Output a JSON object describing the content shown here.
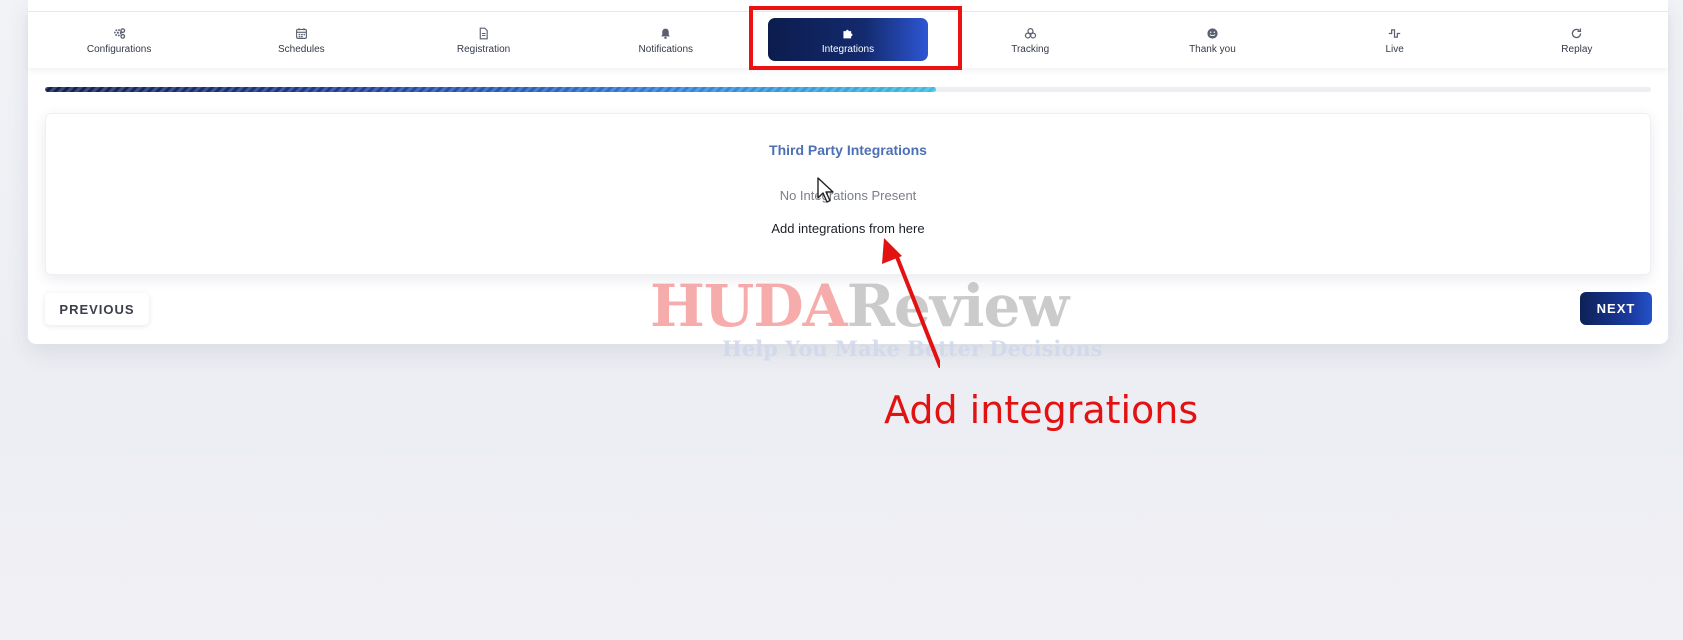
{
  "tabs": [
    {
      "label": "Configurations",
      "icon": "gears-icon"
    },
    {
      "label": "Schedules",
      "icon": "calendar-icon"
    },
    {
      "label": "Registration",
      "icon": "document-icon"
    },
    {
      "label": "Notifications",
      "icon": "bell-icon"
    },
    {
      "label": "Integrations",
      "icon": "puzzle-icon",
      "active": true
    },
    {
      "label": "Tracking",
      "icon": "tracking-icon"
    },
    {
      "label": "Thank you",
      "icon": "smile-icon"
    },
    {
      "label": "Live",
      "icon": "pulse-icon"
    },
    {
      "label": "Replay",
      "icon": "replay-icon"
    }
  ],
  "progress": {
    "fraction": 0.555
  },
  "panel": {
    "title": "Third Party Integrations",
    "empty_text": "No Integrations Present",
    "add_text": "Add integrations from here"
  },
  "buttons": {
    "previous": "PREVIOUS",
    "next": "NEXT"
  },
  "watermark": {
    "part1": "HUDA",
    "part2": "Review",
    "tagline": "Help You Make Better Decisions"
  },
  "annotation": {
    "text": "Add integrations",
    "color": "#e31212"
  },
  "colors": {
    "accent": "#0c1c4e",
    "accent_light": "#2d56d3",
    "title": "#4d6fb4",
    "highlight": "#ee1111"
  }
}
